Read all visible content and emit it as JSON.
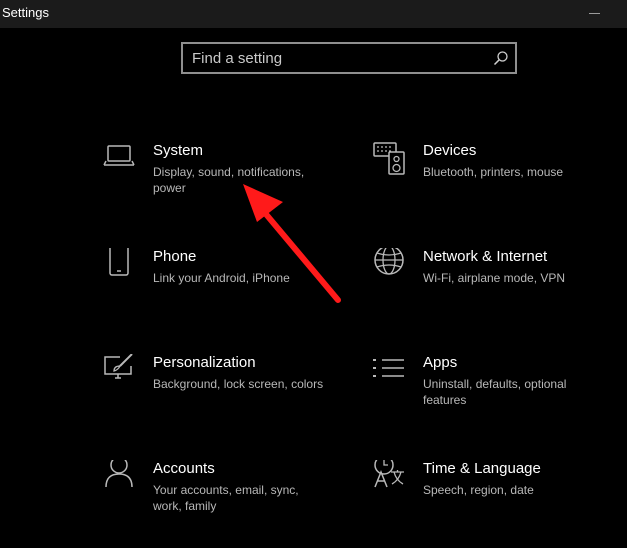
{
  "window": {
    "title": "Settings"
  },
  "search": {
    "placeholder": "Find a setting"
  },
  "tiles": [
    {
      "title": "System",
      "description": "Display, sound, notifications, power",
      "icon": "laptop-icon"
    },
    {
      "title": "Devices",
      "description": "Bluetooth, printers, mouse",
      "icon": "devices-icon"
    },
    {
      "title": "Phone",
      "description": "Link your Android, iPhone",
      "icon": "phone-icon"
    },
    {
      "title": "Network & Internet",
      "description": "Wi-Fi, airplane mode, VPN",
      "icon": "globe-icon"
    },
    {
      "title": "Personalization",
      "description": "Background, lock screen, colors",
      "icon": "paint-icon"
    },
    {
      "title": "Apps",
      "description": "Uninstall, defaults, optional features",
      "icon": "apps-list-icon"
    },
    {
      "title": "Accounts",
      "description": "Your accounts, email, sync, work, family",
      "icon": "person-icon"
    },
    {
      "title": "Time & Language",
      "description": "Speech, region, date",
      "icon": "time-language-icon"
    }
  ],
  "annotation": {
    "color": "#ff1a1a",
    "icon": "red-arrow-icon"
  }
}
